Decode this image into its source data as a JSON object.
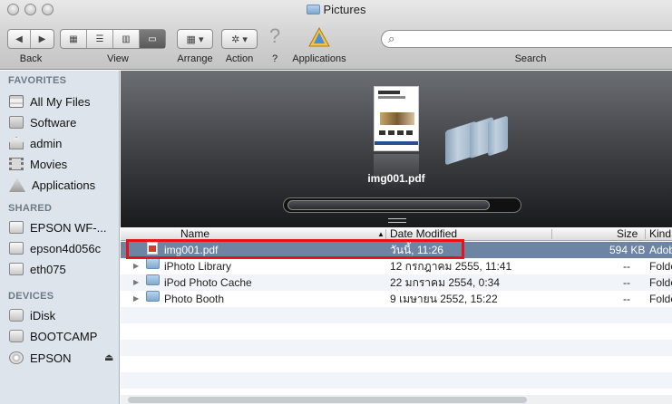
{
  "window": {
    "title": "Pictures"
  },
  "toolbar": {
    "back_label": "Back",
    "view_label": "View",
    "arrange_label": "Arrange",
    "action_label": "Action",
    "help_label": "?",
    "applications_label": "Applications",
    "search_label": "Search"
  },
  "sidebar": {
    "favorites_header": "FAVORITES",
    "favorites": [
      {
        "label": "All My Files",
        "icon": "all-files-icon"
      },
      {
        "label": "Software",
        "icon": "folder-icon"
      },
      {
        "label": "admin",
        "icon": "home-icon"
      },
      {
        "label": "Movies",
        "icon": "movies-icon"
      },
      {
        "label": "Applications",
        "icon": "applications-icon"
      }
    ],
    "shared_header": "SHARED",
    "shared": [
      {
        "label": "EPSON WF-...",
        "icon": "network-computer-icon"
      },
      {
        "label": "epson4d056c",
        "icon": "network-computer-icon"
      },
      {
        "label": "eth075",
        "icon": "network-computer-icon"
      }
    ],
    "devices_header": "DEVICES",
    "devices": [
      {
        "label": "iDisk",
        "icon": "idisk-icon"
      },
      {
        "label": "BOOTCAMP",
        "icon": "disk-icon"
      },
      {
        "label": "EPSON",
        "icon": "cd-icon"
      }
    ]
  },
  "coverflow": {
    "selected_label": "img001.pdf"
  },
  "columns": {
    "name": "Name",
    "date": "Date Modified",
    "size": "Size",
    "kind": "Kind"
  },
  "rows": [
    {
      "name": "img001.pdf",
      "date": "วันนี้, 11:26",
      "size": "594 KB",
      "kind": "Adob",
      "type": "pdf"
    },
    {
      "name": "iPhoto Library",
      "date": "12 กรกฎาคม 2555, 11:41",
      "size": "--",
      "kind": "Folde",
      "type": "folder"
    },
    {
      "name": "iPod Photo Cache",
      "date": "22 มกราคม 2554, 0:34",
      "size": "--",
      "kind": "Folde",
      "type": "folder"
    },
    {
      "name": "Photo Booth",
      "date": "9 เมษายน 2552, 15:22",
      "size": "--",
      "kind": "Folde",
      "type": "folder"
    }
  ],
  "colors": {
    "selection": "#6d84a3",
    "highlight_box": "#e8121c",
    "sidebar_bg": "#dde4ec"
  }
}
